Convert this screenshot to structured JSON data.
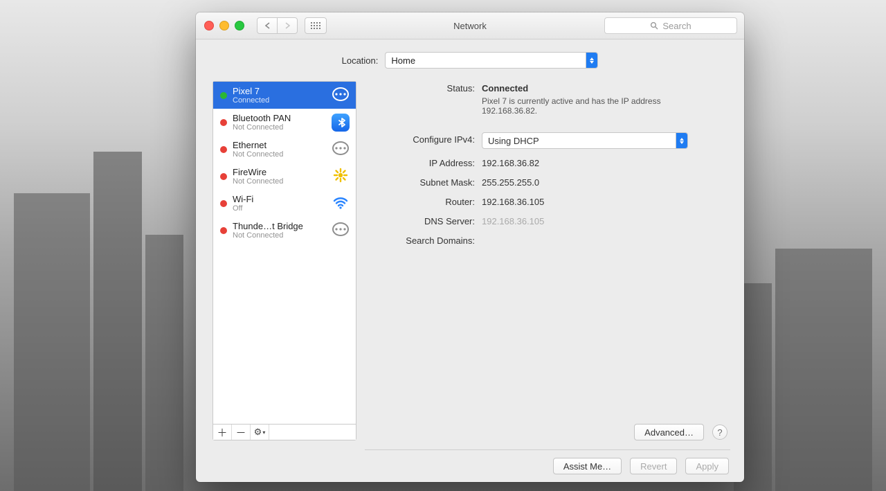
{
  "window": {
    "title": "Network",
    "search_placeholder": "Search"
  },
  "location": {
    "label": "Location:",
    "value": "Home"
  },
  "services": [
    {
      "name": "Pixel 7",
      "status": "Connected",
      "dot": "green",
      "icon": "ethernet",
      "selected": true
    },
    {
      "name": "Bluetooth PAN",
      "status": "Not Connected",
      "dot": "red",
      "icon": "bluetooth",
      "selected": false
    },
    {
      "name": "Ethernet",
      "status": "Not Connected",
      "dot": "red",
      "icon": "ethernet",
      "selected": false
    },
    {
      "name": "FireWire",
      "status": "Not Connected",
      "dot": "red",
      "icon": "firewire",
      "selected": false
    },
    {
      "name": "Wi-Fi",
      "status": "Off",
      "dot": "red",
      "icon": "wifi",
      "selected": false
    },
    {
      "name": "Thunde…t Bridge",
      "status": "Not Connected",
      "dot": "red",
      "icon": "ethernet",
      "selected": false
    }
  ],
  "details": {
    "status_label": "Status:",
    "status_value": "Connected",
    "status_message": "Pixel 7 is currently active and has the IP address 192.168.36.82.",
    "configure_label": "Configure IPv4:",
    "configure_value": "Using DHCP",
    "ip_label": "IP Address:",
    "ip_value": "192.168.36.82",
    "subnet_label": "Subnet Mask:",
    "subnet_value": "255.255.255.0",
    "router_label": "Router:",
    "router_value": "192.168.36.105",
    "dns_label": "DNS Server:",
    "dns_value": "192.168.36.105",
    "search_label": "Search Domains:",
    "search_value": ""
  },
  "buttons": {
    "advanced": "Advanced…",
    "assist": "Assist Me…",
    "revert": "Revert",
    "apply": "Apply"
  }
}
